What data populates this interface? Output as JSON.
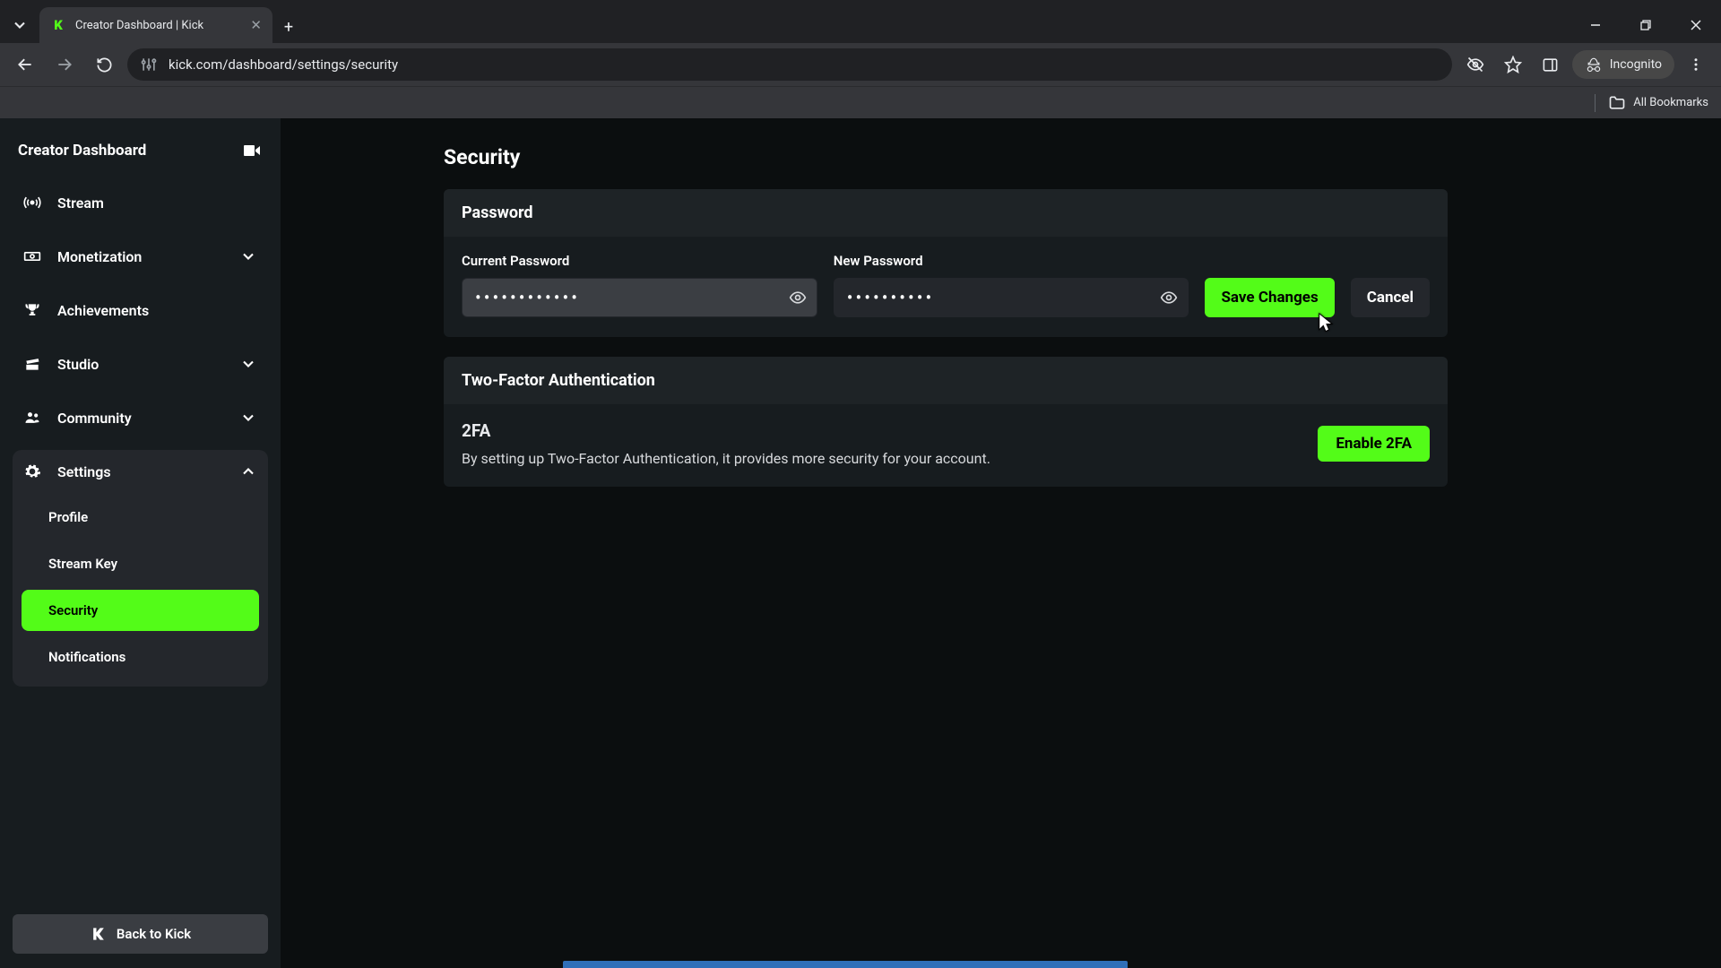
{
  "browser": {
    "tab_title": "Creator Dashboard | Kick",
    "url": "kick.com/dashboard/settings/security",
    "incognito_label": "Incognito",
    "all_bookmarks": "All Bookmarks"
  },
  "sidebar": {
    "title": "Creator Dashboard",
    "items": [
      {
        "label": "Stream",
        "icon": "broadcast"
      },
      {
        "label": "Monetization",
        "icon": "cash",
        "expandable": true
      },
      {
        "label": "Achievements",
        "icon": "trophy"
      },
      {
        "label": "Studio",
        "icon": "clapper",
        "expandable": true
      },
      {
        "label": "Community",
        "icon": "people",
        "expandable": true
      },
      {
        "label": "Settings",
        "icon": "gear",
        "expandable": true,
        "expanded": true
      }
    ],
    "settings_sub": [
      {
        "label": "Profile"
      },
      {
        "label": "Stream Key"
      },
      {
        "label": "Security",
        "active": true
      },
      {
        "label": "Notifications"
      }
    ],
    "back_label": "Back to Kick"
  },
  "page": {
    "title": "Security",
    "password": {
      "section_title": "Password",
      "current_label": "Current Password",
      "current_value": "••••••••••••",
      "new_label": "New Password",
      "new_value": "••••••••••",
      "save_label": "Save Changes",
      "cancel_label": "Cancel"
    },
    "tfa": {
      "section_title": "Two-Factor Authentication",
      "heading": "2FA",
      "description": "By setting up Two-Factor Authentication, it provides more security for your account.",
      "enable_label": "Enable 2FA"
    }
  }
}
